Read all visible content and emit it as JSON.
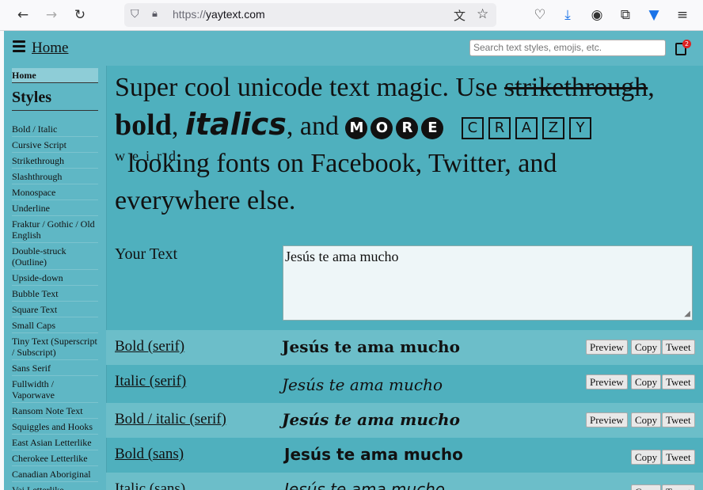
{
  "browser": {
    "url_prefix": "https://",
    "url_host": "yaytext.com"
  },
  "header": {
    "home_label": "Home",
    "search_placeholder": "Search text styles, emojis, etc.",
    "clipboard_count": "2"
  },
  "sidebar": {
    "home": "Home",
    "title": "Styles",
    "items": [
      "Bold / Italic",
      "Cursive Script",
      "Strikethrough",
      "Slashthrough",
      "Monospace",
      "Underline",
      "Fraktur / Gothic / Old English",
      "Double-struck (Outline)",
      "Upside-down",
      "Bubble Text",
      "Square Text",
      "Small Caps",
      "Tiny Text (Superscript / Subscript)",
      "Sans Serif",
      "Fullwidth / Vaporwave",
      "Ransom Note Text",
      "Squiggles and Hooks",
      "East Asian Letterlike",
      "Cherokee Letterlike",
      "Canadian Aboriginal",
      "Vai Letterlike"
    ]
  },
  "hero": {
    "line1": "Super cool unicode text magic. Use ",
    "strike": "strikethrough",
    "comma1": ",",
    "bold": "bold",
    "comma2": ", ",
    "italics": "italics",
    "and": ", and ",
    "more": [
      "M",
      "O",
      "R",
      "E"
    ],
    "crazy": [
      "C",
      "R",
      "A",
      "Z",
      "Y"
    ],
    "weird": "weird",
    "line3": "looking fonts on Facebook, Twitter, and",
    "line4": "everywhere else."
  },
  "input": {
    "label": "Your Text",
    "value": "Jesús te ama mucho"
  },
  "buttons": {
    "preview": "Preview",
    "copy": "Copy",
    "tweet": "Tweet"
  },
  "styles": [
    {
      "name": "Bold (serif)",
      "sample": "Jesús te ama mucho",
      "preview": true
    },
    {
      "name": "Italic (serif)",
      "sample": "Jesús te ama mucho",
      "preview": true
    },
    {
      "name": "Bold / italic (serif)",
      "sample": "Jesús te ama mucho",
      "preview": true
    },
    {
      "name": "Bold (sans)",
      "sample": "Jesús te ama mucho",
      "preview": false
    },
    {
      "name": "Italic (sans)",
      "sample": "Jesús te ama mucho",
      "preview": false
    }
  ]
}
